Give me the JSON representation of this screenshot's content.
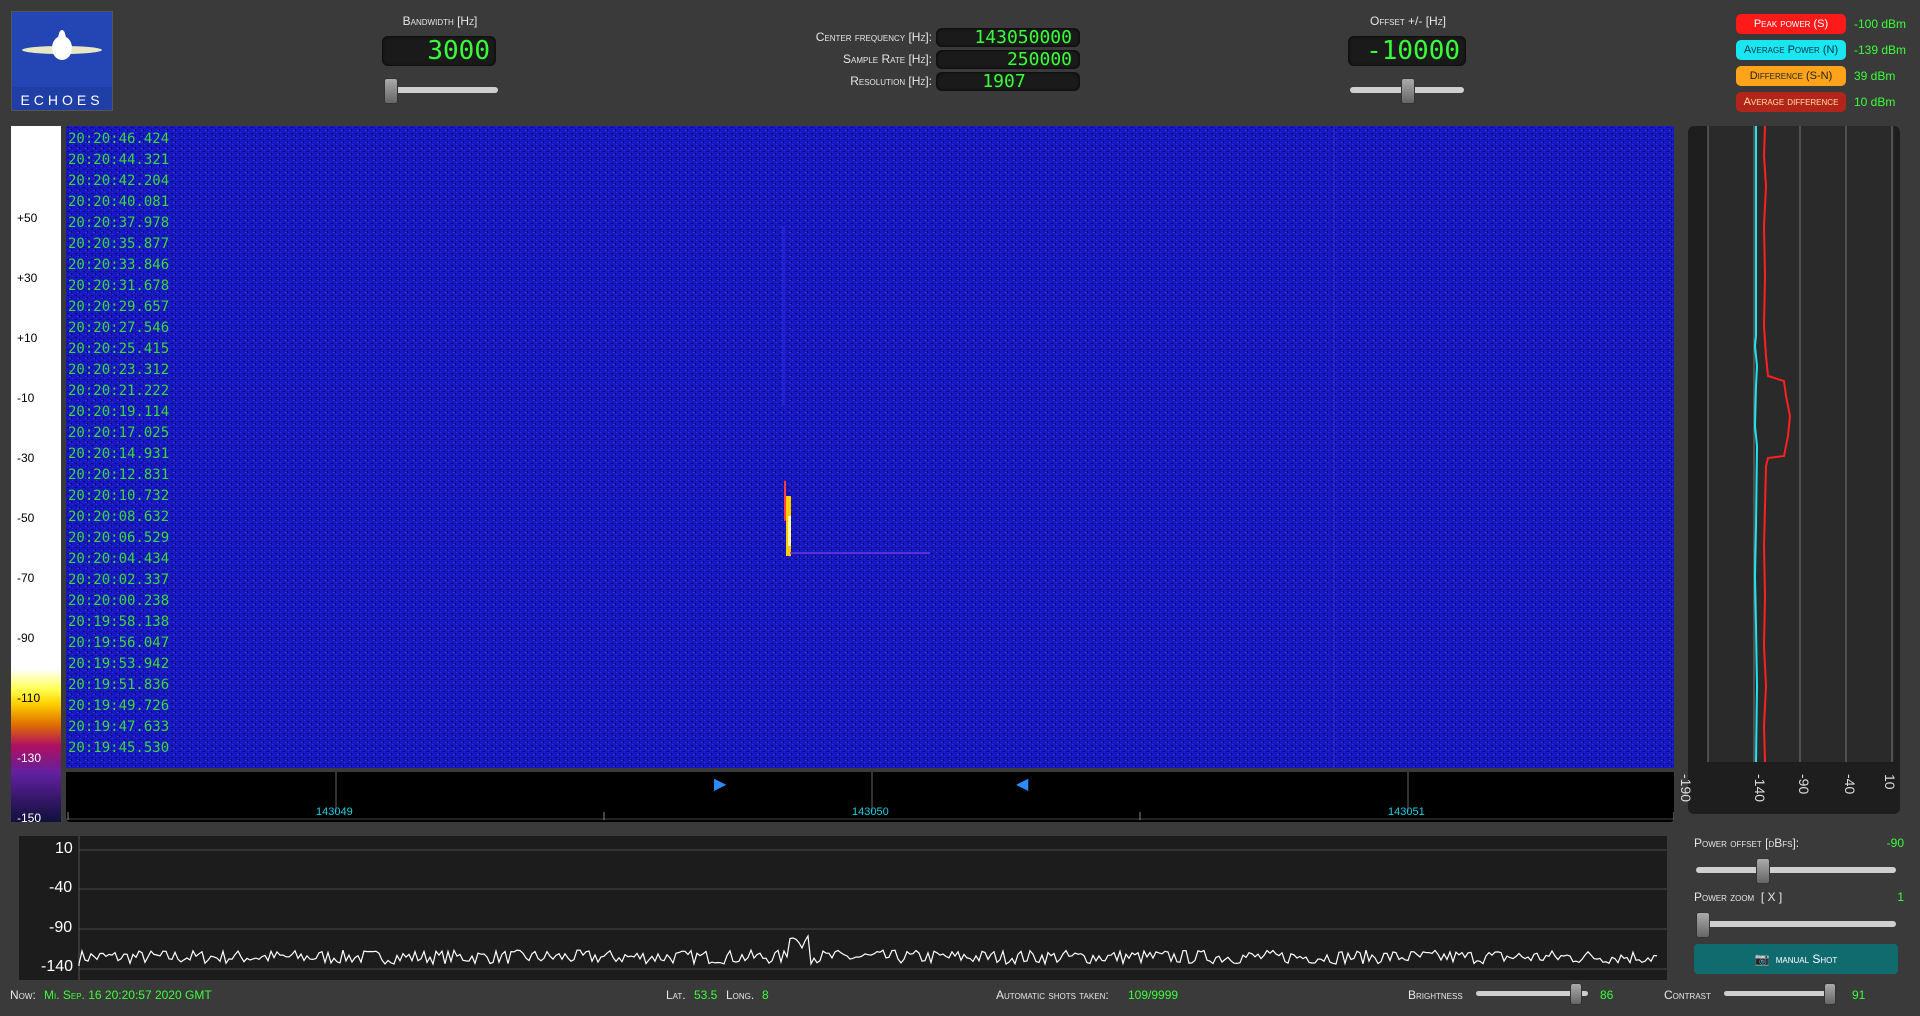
{
  "logo": {
    "text": "ECHOES"
  },
  "bandwidth": {
    "label": "Bandwidth [Hz]",
    "value": "3000",
    "slider": 0.0
  },
  "center": {
    "rows": [
      {
        "label": "Center frequency [Hz]:",
        "value": "143050000"
      },
      {
        "label": "Sample Rate [Hz]:",
        "value": "250000"
      },
      {
        "label": "Resolution [Hz]:",
        "value": "1907"
      }
    ]
  },
  "offset": {
    "label": "Offset +/- [Hz]",
    "value": "-10000",
    "slider": 0.5
  },
  "legend": [
    {
      "label": "Peak power (S)",
      "value": "-100 dBm",
      "bg": "#ff1a1a",
      "fg": "#ffffff"
    },
    {
      "label": "Average Power (N)",
      "value": "-139 dBm",
      "bg": "#19e6f0",
      "fg": "#003344"
    },
    {
      "label": "Difference (S-N)",
      "value": "39 dBm",
      "bg": "#ffa41a",
      "fg": "#222222"
    },
    {
      "label": "Average difference",
      "value": "10 dBm",
      "bg": "#b3241a",
      "fg": "#ffe0a0"
    }
  ],
  "colorscale": {
    "ticks": [
      "+50",
      "+30",
      "+10",
      "-10",
      "-30",
      "-50",
      "-70",
      "-90",
      "-110",
      "-130",
      "-150"
    ]
  },
  "timestamps": [
    "20:20:46.424",
    "20:20:44.321",
    "20:20:42.204",
    "20:20:40.081",
    "20:20:37.978",
    "20:20:35.877",
    "20:20:33.846",
    "20:20:31.678",
    "20:20:29.657",
    "20:20:27.546",
    "20:20:25.415",
    "20:20:23.312",
    "20:20:21.222",
    "20:20:19.114",
    "20:20:17.025",
    "20:20:14.931",
    "20:20:12.831",
    "20:20:10.732",
    "20:20:08.632",
    "20:20:06.529",
    "20:20:04.434",
    "20:20:02.337",
    "20:20:00.238",
    "20:19:58.138",
    "20:19:56.047",
    "20:19:53.942",
    "20:19:51.836",
    "20:19:49.726",
    "20:19:47.633",
    "20:19:45.530"
  ],
  "freq_axis": {
    "labels": [
      "143049",
      "143050",
      "143051"
    ]
  },
  "side_axis": {
    "labels": [
      "-190",
      "-140",
      "-90",
      "-40",
      "10"
    ]
  },
  "spectrum": {
    "yticks": [
      "10",
      "-40",
      "-90",
      "-140"
    ]
  },
  "power_offset": {
    "label": "Power offset [dBfs]:",
    "value": "-90",
    "slider": 0.3
  },
  "power_zoom": {
    "label": "Power zoom  [ X ]",
    "value": "1",
    "slider": 0.0
  },
  "manual_shot": {
    "label": "manual Shot"
  },
  "status": {
    "now_label": "Now:",
    "now_value": "Mi. Sep. 16 20:20:57 2020 GMT",
    "lat_label": "Lat.",
    "lat_value": "53.5",
    "long_label": "Long.",
    "long_value": "8",
    "shots_label": "Automatic shots taken:",
    "shots_value": "109/9999",
    "brightness_label": "Brightness",
    "brightness_value": "86",
    "brightness_slider": 0.86,
    "contrast_label": "Contrast",
    "contrast_value": "91",
    "contrast_slider": 0.91
  }
}
